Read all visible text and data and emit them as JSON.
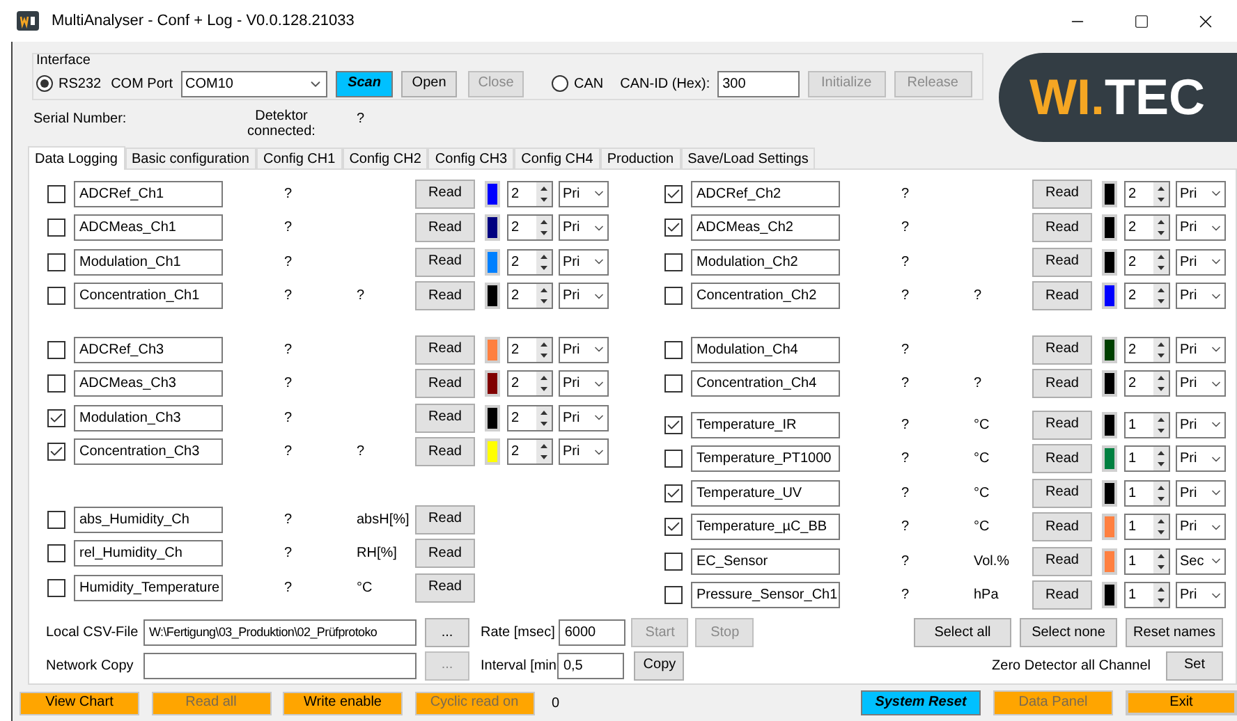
{
  "window": {
    "title": "MultiAnalyser - Conf + Log - V0.0.128.21033"
  },
  "interface": {
    "label": "Interface",
    "connections": [
      {
        "label": "RS232",
        "selected": true
      },
      {
        "label": "CAN",
        "selected": false
      }
    ],
    "com_port_label": "COM Port",
    "com_port": "COM10",
    "com_buttons": [
      {
        "label": "Scan",
        "kind": "accent",
        "disabled": false
      },
      {
        "label": "Open",
        "kind": "plain",
        "disabled": false
      },
      {
        "label": "Close",
        "kind": "plain",
        "disabled": true
      }
    ],
    "can_id_label": "CAN-ID (Hex):",
    "can_id": "300",
    "can_buttons": [
      {
        "label": "Initialize",
        "disabled": true
      },
      {
        "label": "Release",
        "disabled": true
      }
    ]
  },
  "logo": {
    "primary": "WI",
    "dot": ".",
    "secondary": "TEC"
  },
  "status": {
    "serial_label": "Serial Number:",
    "detector_label": "Detektor connected:",
    "detector_value": "?"
  },
  "tabs": [
    {
      "label": "Data Logging",
      "selected": true
    },
    {
      "label": "Basic configuration",
      "selected": false
    },
    {
      "label": "Config CH1",
      "selected": false
    },
    {
      "label": "Config CH2",
      "selected": false
    },
    {
      "label": "Config CH3",
      "selected": false
    },
    {
      "label": "Config CH4",
      "selected": false
    },
    {
      "label": "Production",
      "selected": false
    },
    {
      "label": "Save/Load Settings",
      "selected": false
    }
  ],
  "columns": [
    {
      "groups": [
        {
          "rows": [
            {
              "kind": "channel",
              "checked": false,
              "name": "ADCRef_Ch1",
              "value": "?",
              "read": "Read",
              "color": "#0000ff",
              "decimals": "2",
              "mode": "Pri"
            },
            {
              "kind": "channel",
              "checked": false,
              "name": "ADCMeas_Ch1",
              "value": "?",
              "read": "Read",
              "color": "#000080",
              "decimals": "2",
              "mode": "Pri"
            },
            {
              "kind": "channel",
              "checked": false,
              "name": "Modulation_Ch1",
              "value": "?",
              "read": "Read",
              "color": "#0080ff",
              "decimals": "2",
              "mode": "Pri"
            },
            {
              "kind": "channel",
              "checked": false,
              "name": "Concentration_Ch1",
              "value": "?",
              "unit": "?",
              "read": "Read",
              "color": "#000000",
              "decimals": "2",
              "mode": "Pri"
            }
          ]
        },
        {
          "rows": [
            {
              "kind": "channel",
              "checked": false,
              "name": "ADCRef_Ch3",
              "value": "?",
              "read": "Read",
              "color": "#ff8040",
              "decimals": "2",
              "mode": "Pri"
            },
            {
              "kind": "channel",
              "checked": false,
              "name": "ADCMeas_Ch3",
              "value": "?",
              "read": "Read",
              "color": "#800000",
              "decimals": "2",
              "mode": "Pri"
            },
            {
              "kind": "channel",
              "checked": true,
              "name": "Modulation_Ch3",
              "value": "?",
              "read": "Read",
              "color": "#000000",
              "decimals": "2",
              "mode": "Pri"
            },
            {
              "kind": "channel",
              "checked": true,
              "name": "Concentration_Ch3",
              "value": "?",
              "unit": "?",
              "read": "Read",
              "color": "#ffff00",
              "decimals": "2",
              "mode": "Pri"
            }
          ]
        },
        {
          "rows": [
            {
              "kind": "sensor",
              "checked": false,
              "name": "abs_Humidity_Ch",
              "value": "?",
              "unit": "absH[%]",
              "read": "Read"
            },
            {
              "kind": "sensor",
              "checked": false,
              "name": "rel_Humidity_Ch",
              "value": "?",
              "unit": "RH[%]",
              "read": "Read"
            },
            {
              "kind": "sensor",
              "checked": false,
              "name": "Humidity_Temperature",
              "value": "?",
              "unit": "°C",
              "read": "Read"
            }
          ]
        }
      ]
    },
    {
      "groups": [
        {
          "rows": [
            {
              "kind": "channel",
              "checked": true,
              "name": "ADCRef_Ch2",
              "value": "?",
              "read": "Read",
              "color": "#000000",
              "decimals": "2",
              "mode": "Pri"
            },
            {
              "kind": "channel",
              "checked": true,
              "name": "ADCMeas_Ch2",
              "value": "?",
              "read": "Read",
              "color": "#000000",
              "decimals": "2",
              "mode": "Pri"
            },
            {
              "kind": "channel",
              "checked": false,
              "name": "Modulation_Ch2",
              "value": "?",
              "read": "Read",
              "color": "#000000",
              "decimals": "2",
              "mode": "Pri"
            },
            {
              "kind": "channel",
              "checked": false,
              "name": "Concentration_Ch2",
              "value": "?",
              "unit": "?",
              "read": "Read",
              "color": "#0000ff",
              "decimals": "2",
              "mode": "Pri"
            }
          ]
        },
        {
          "rows": [
            {
              "kind": "channel",
              "checked": false,
              "name": "Modulation_Ch4",
              "value": "?",
              "read": "Read",
              "color": "#004000",
              "decimals": "2",
              "mode": "Pri"
            },
            {
              "kind": "channel",
              "checked": false,
              "name": "Concentration_Ch4",
              "value": "?",
              "unit": "?",
              "read": "Read",
              "color": "#000000",
              "decimals": "2",
              "mode": "Pri"
            }
          ]
        },
        {
          "rows": [
            {
              "kind": "channel",
              "checked": true,
              "name": "Temperature_IR",
              "value": "?",
              "unit": "°C",
              "read": "Read",
              "color": "#000000",
              "decimals": "1",
              "mode": "Pri"
            },
            {
              "kind": "channel",
              "checked": false,
              "name": "Temperature_PT1000",
              "value": "?",
              "unit": "°C",
              "read": "Read",
              "color": "#008040",
              "decimals": "1",
              "mode": "Pri"
            },
            {
              "kind": "channel",
              "checked": true,
              "name": "Temperature_UV",
              "value": "?",
              "unit": "°C",
              "read": "Read",
              "color": "#000000",
              "decimals": "1",
              "mode": "Pri"
            },
            {
              "kind": "channel",
              "checked": true,
              "name": "Temperature_µC_BB",
              "value": "?",
              "unit": "°C",
              "read": "Read",
              "color": "#ff8040",
              "decimals": "1",
              "mode": "Pri"
            },
            {
              "kind": "channel",
              "checked": false,
              "name": "EC_Sensor",
              "value": "?",
              "unit": "Vol.%",
              "read": "Read",
              "color": "#ff8040",
              "decimals": "1",
              "mode": "Sec"
            },
            {
              "kind": "channel",
              "checked": false,
              "name": "Pressure_Sensor_Ch1",
              "value": "?",
              "unit": "hPa",
              "read": "Read",
              "color": "#000000",
              "decimals": "1",
              "mode": "Pri"
            }
          ]
        }
      ]
    }
  ],
  "logging": {
    "csv_label": "Local CSV-File",
    "csv_path": "W:\\Fertigung\\03_Produktion\\02_Prüfprotoko",
    "csv_browse": {
      "label": "...",
      "disabled": false
    },
    "rate_label": "Rate [msec]",
    "rate": "6000",
    "start": {
      "label": "Start",
      "disabled": true
    },
    "stop": {
      "label": "Stop",
      "disabled": true
    },
    "network_label": "Network Copy",
    "network_browse": {
      "label": "...",
      "disabled": true
    },
    "interval_label": "Interval [min",
    "interval": "0,5",
    "copy": {
      "label": "Copy",
      "disabled": false
    },
    "selection_buttons": [
      "Select all",
      "Select none",
      "Reset names"
    ],
    "zero_label": "Zero Detector all Channel",
    "set": "Set"
  },
  "bottom_left": [
    {
      "label": "View Chart",
      "disabled": false
    },
    {
      "label": "Read all",
      "disabled": true
    },
    {
      "label": "Write enable",
      "disabled": false
    },
    {
      "label": "Cyclic read on",
      "disabled": true
    }
  ],
  "counter": "0",
  "bottom_right": [
    {
      "label": "System Reset",
      "kind": "accent",
      "disabled": false,
      "focused": false
    },
    {
      "label": "Data Panel",
      "kind": "orange",
      "disabled": true,
      "focused": false
    },
    {
      "label": "Exit",
      "kind": "orange",
      "disabled": false,
      "focused": true
    }
  ]
}
